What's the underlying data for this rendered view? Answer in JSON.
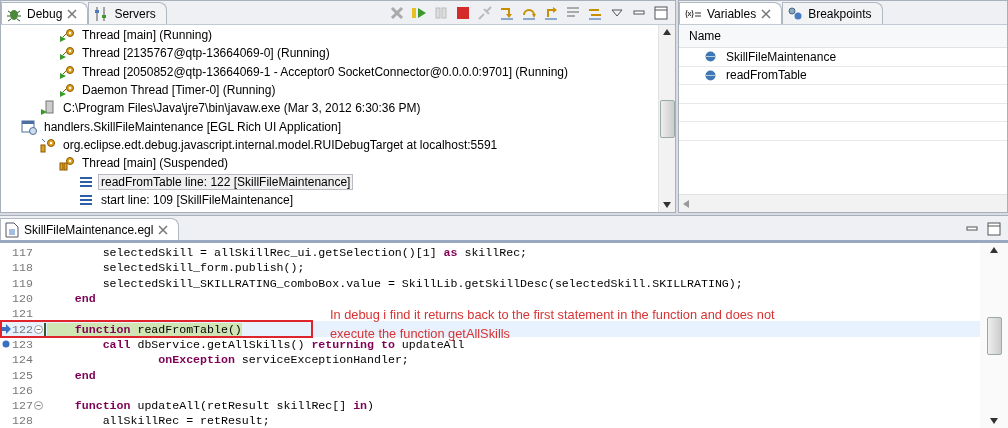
{
  "debug_view": {
    "tabs": [
      {
        "label": "Debug",
        "selected": true,
        "closable": true
      },
      {
        "label": "Servers",
        "selected": false,
        "closable": false
      }
    ],
    "previous_threads": [
      {
        "label": "Thread [main] (Running)",
        "selected": false
      },
      {
        "label": "Thread [2135767@qtp-13664069-0] (Running)",
        "selected": false
      },
      {
        "label": "Thread [2050852@qtp-13664069-1 - Acceptor0 SocketConnector@0.0.0.0:9701] (Running)",
        "selected": false
      },
      {
        "label": "Daemon Thread [Timer-0] (Running)",
        "selected": false
      }
    ],
    "process": {
      "label": "C:\\Program Files\\Java\\jre7\\bin\\javaw.exe (Mar 3, 2012 6:30:36 PM)",
      "selected": false
    },
    "tree": [
      {
        "kind": "application",
        "label": "handlers.SkillFileMaintenance [EGL Rich UI Application]",
        "selected": false,
        "children": [
          {
            "kind": "target",
            "label": "org.eclipse.edt.debug.javascript.internal.model.RUIDebugTarget at localhost:5591",
            "selected": false,
            "children": [
              {
                "kind": "thread",
                "label": "Thread [main] (Suspended)",
                "selected": false,
                "children": [
                  {
                    "kind": "frame",
                    "label": "readFromTable line: 122 [SkillFileMaintenance]",
                    "selected": true
                  },
                  {
                    "kind": "frame",
                    "label": "start line: 109 [SkillFileMaintenance]",
                    "selected": false
                  }
                ]
              }
            ]
          }
        ]
      }
    ]
  },
  "variables_view": {
    "tabs": [
      {
        "label": "Variables",
        "selected": true,
        "closable": true
      },
      {
        "label": "Breakpoints",
        "selected": false,
        "closable": false
      }
    ],
    "columns": [
      "Name"
    ],
    "rows": [
      {
        "name": "SkillFileMaintenance"
      },
      {
        "name": "readFromTable"
      }
    ]
  },
  "editor": {
    "tab": {
      "label": "SkillFileMaintenance.egl",
      "selected": true
    },
    "lines": [
      {
        "number": "117",
        "current": false,
        "breakpoint": false,
        "foldable": false,
        "segments": [
          {
            "kind": "plain",
            "text": "        selectedSkill = allSkillRec_ui.getSelection()[1] "
          },
          {
            "kind": "keyword",
            "text": "as"
          },
          {
            "kind": "plain",
            "text": " skillRec;"
          }
        ]
      },
      {
        "number": "118",
        "current": false,
        "breakpoint": false,
        "foldable": false,
        "segments": [
          {
            "kind": "plain",
            "text": "        selectedSkill_form.publish();"
          }
        ]
      },
      {
        "number": "119",
        "current": false,
        "breakpoint": false,
        "foldable": false,
        "segments": [
          {
            "kind": "plain",
            "text": "        selectedSkill_SKILLRATING_comboBox.value = SkillLib.getSkillDesc(selectedSkill.SKILLRATING);"
          }
        ]
      },
      {
        "number": "120",
        "current": false,
        "breakpoint": false,
        "foldable": false,
        "segments": [
          {
            "kind": "keyword",
            "text": "    end"
          }
        ]
      },
      {
        "number": "121",
        "current": false,
        "breakpoint": false,
        "foldable": false
      },
      {
        "number": "122",
        "current": true,
        "breakpoint": false,
        "foldable": true,
        "segments": [
          {
            "kind": "keyword",
            "text": "    function"
          },
          {
            "kind": "plain",
            "text": " readFromTable()"
          }
        ]
      },
      {
        "number": "123",
        "current": false,
        "breakpoint": true,
        "foldable": false,
        "segments": [
          {
            "kind": "keyword",
            "text": "        call"
          },
          {
            "kind": "plain",
            "text": " dbService.getAllSkills() "
          },
          {
            "kind": "keyword",
            "text": "returning to"
          },
          {
            "kind": "plain",
            "text": " updateAll"
          }
        ]
      },
      {
        "number": "124",
        "current": false,
        "breakpoint": false,
        "foldable": false,
        "segments": [
          {
            "kind": "keyword",
            "text": "                onException"
          },
          {
            "kind": "plain",
            "text": " serviceExceptionHandler;"
          }
        ]
      },
      {
        "number": "125",
        "current": false,
        "breakpoint": false,
        "foldable": false,
        "segments": [
          {
            "kind": "keyword",
            "text": "    end"
          }
        ]
      },
      {
        "number": "126",
        "current": false,
        "breakpoint": false,
        "foldable": false
      },
      {
        "number": "127",
        "current": false,
        "breakpoint": false,
        "foldable": true,
        "segments": [
          {
            "kind": "keyword",
            "text": "    function"
          },
          {
            "kind": "plain",
            "text": " updateAll(retResult skillRec[] "
          },
          {
            "kind": "keyword",
            "text": "in"
          },
          {
            "kind": "plain",
            "text": ")"
          }
        ]
      },
      {
        "number": "128",
        "current": false,
        "breakpoint": false,
        "foldable": false,
        "segments": [
          {
            "kind": "plain",
            "text": "        allSkillRec = retResult;"
          }
        ]
      }
    ],
    "annotation": [
      "In debug i find it returns back to the first statement in the function and does not",
      "execute the function getAllSkills"
    ]
  }
}
